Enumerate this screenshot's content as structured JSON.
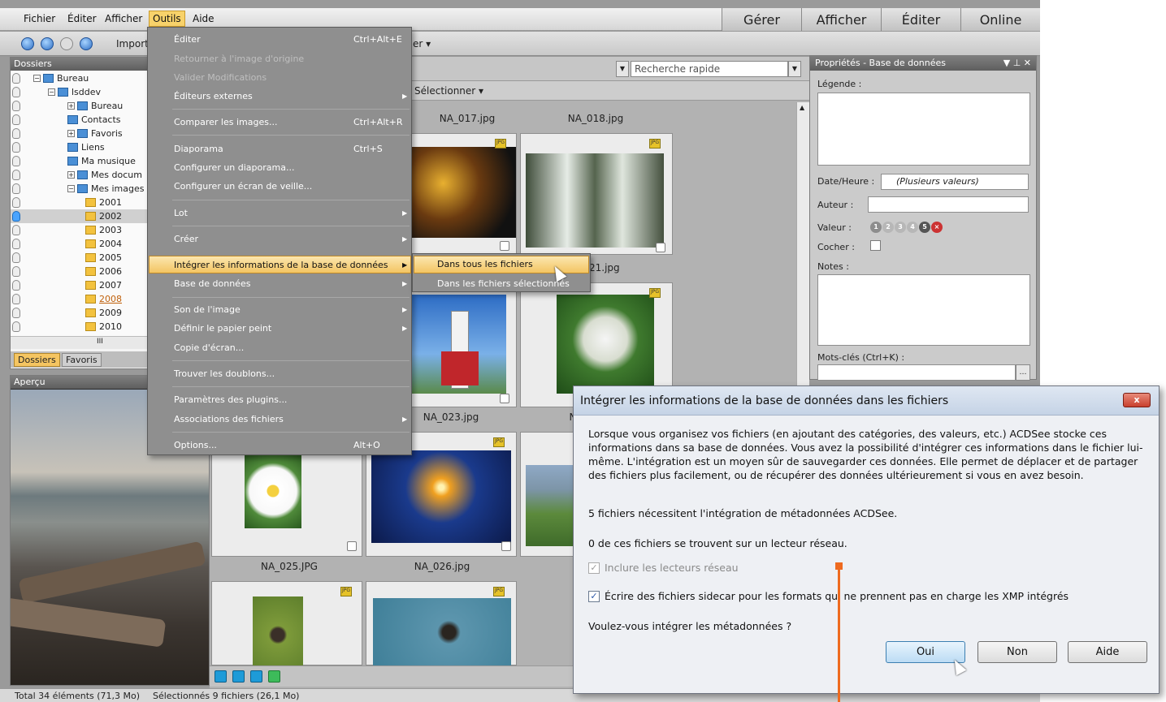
{
  "menubar": {
    "items": [
      "Fichier",
      "Éditer",
      "Afficher",
      "Outils",
      "Aide"
    ],
    "modes": [
      "Gérer",
      "Afficher",
      "Éditer",
      "Online"
    ]
  },
  "toolbar": {
    "import_label": "Import",
    "er_label": "er ▾"
  },
  "left": {
    "title": "Dossiers",
    "tree": [
      "Bureau",
      "lsddev",
      "Bureau",
      "Contacts",
      "Favoris",
      "Liens",
      "Ma musique",
      "Mes docum",
      "Mes images",
      "2001",
      "2002",
      "2003",
      "2004",
      "2005",
      "2006",
      "2007",
      "2008",
      "2009",
      "2010"
    ],
    "scroll_label": "III",
    "tabs": [
      "Dossiers",
      "Favoris"
    ],
    "preview_title": "Aperçu"
  },
  "browser": {
    "search_placeholder": "Recherche rapide",
    "select_label": "Sélectionner ▾",
    "files": [
      "NA_017.jpg",
      "NA_018.jpg",
      "021.jpg",
      "NA_023.jpg",
      "N",
      "NA_025.JPG",
      "NA_026.jpg"
    ],
    "badge": "JPG"
  },
  "props": {
    "title": "Propriétés - Base de données",
    "legend_label": "Légende :",
    "date_label": "Date/Heure :",
    "date_value": "(Plusieurs valeurs)",
    "author_label": "Auteur :",
    "value_label": "Valeur :",
    "check_label": "Cocher :",
    "notes_label": "Notes :",
    "keywords_label": "Mots-clés (Ctrl+K) :",
    "rating": [
      "1",
      "2",
      "3",
      "4",
      "5",
      "×"
    ]
  },
  "menu": {
    "items": [
      {
        "label": "Éditer",
        "shortcut": "Ctrl+Alt+E"
      },
      {
        "label": "Retourner à l'image d'origine",
        "disabled": true
      },
      {
        "label": "Valider Modifications",
        "disabled": true
      },
      {
        "label": "Éditeurs externes",
        "sub": true
      },
      {
        "label": "Comparer les images...",
        "shortcut": "Ctrl+Alt+R"
      },
      {
        "label": "Diaporama",
        "shortcut": "Ctrl+S"
      },
      {
        "label": "Configurer un diaporama..."
      },
      {
        "label": "Configurer un écran de veille..."
      },
      {
        "label": "Lot",
        "sub": true
      },
      {
        "label": "Créer",
        "sub": true
      },
      {
        "label": "Intégrer les informations de la base de données",
        "sub": true,
        "highlight": true
      },
      {
        "label": "Base de données",
        "sub": true
      },
      {
        "label": "Son de l'image",
        "sub": true
      },
      {
        "label": "Définir le papier peint",
        "sub": true
      },
      {
        "label": "Copie d'écran..."
      },
      {
        "label": "Trouver les doublons..."
      },
      {
        "label": "Paramètres des plugins..."
      },
      {
        "label": "Associations des fichiers",
        "sub": true
      },
      {
        "label": "Options...",
        "shortcut": "Alt+O"
      }
    ],
    "submenu": [
      "Dans tous les fichiers",
      "Dans les fichiers sélectionnés"
    ]
  },
  "dialog": {
    "title": "Intégrer les informations de la base de données dans les fichiers",
    "close_label": "x",
    "body": "Lorsque vous organisez vos fichiers (en ajoutant des catégories, des valeurs, etc.) ACDSee stocke ces informations dans sa base de données. Vous avez la possibilité d'intégrer ces informations dans le fichier lui-même. L'intégration est un moyen sûr de sauvegarder ces données. Elle permet de déplacer et de partager des fichiers plus facilement, ou de récupérer des données ultérieurement si vous en avez besoin.",
    "line1": "5 fichiers nécessitent l'intégration de métadonnées ACDSee.",
    "line2": "0 de ces fichiers se trouvent sur un lecteur réseau.",
    "chk1": "Inclure les lecteurs réseau",
    "chk2": "Écrire des fichiers sidecar pour les formats qui ne prennent pas en charge les XMP intégrés",
    "question": "Voulez-vous intégrer les métadonnées ?",
    "buttons": [
      "Oui",
      "Non",
      "Aide"
    ],
    "check_mark": "✓"
  },
  "status": {
    "total": "Total 34 éléments  (71,3 Mo)",
    "selected": "Sélectionnés 9 fichiers (26,1 Mo)"
  },
  "colors": {
    "accent": "#f3c562",
    "callout": "#ee6a1f"
  }
}
